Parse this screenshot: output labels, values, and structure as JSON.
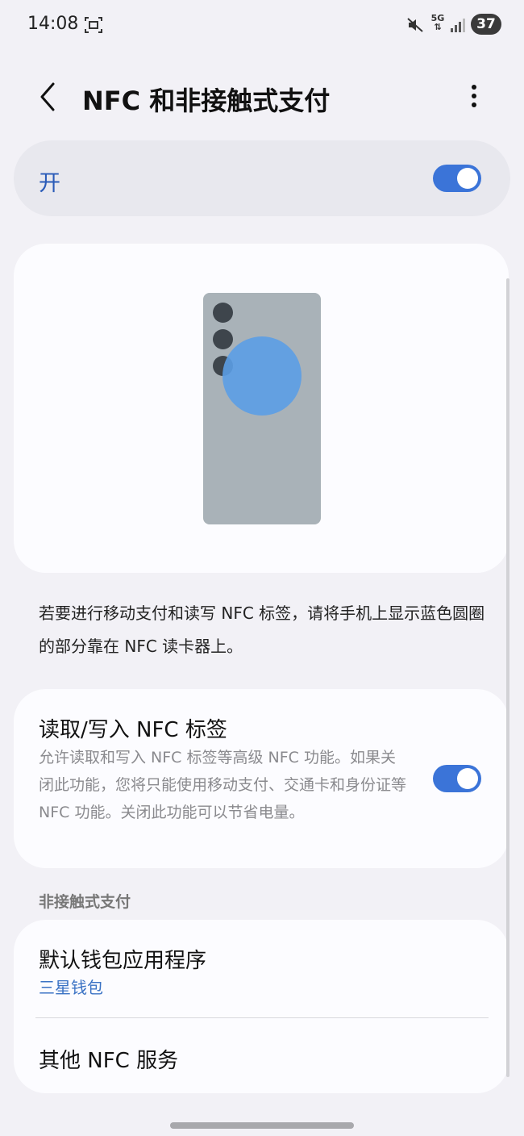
{
  "status_bar": {
    "time": "14:08",
    "network": "5G",
    "battery": "37",
    "icons": [
      "screenshot-icon",
      "mute-icon",
      "signal-icon",
      "battery-icon"
    ]
  },
  "header": {
    "title": "NFC 和非接触式支付",
    "icons": [
      "back-icon",
      "more-vertical-icon"
    ]
  },
  "master_toggle": {
    "label": "开",
    "on": true
  },
  "description": "若要进行移动支付和读写 NFC 标签，请将手机上显示蓝色圆圈的部分靠在 NFC 读卡器上。",
  "read_write": {
    "title": "读取/写入 NFC 标签",
    "subtitle": "允许读取和写入 NFC 标签等高级 NFC 功能。如果关闭此功能，您将只能使用移动支付、交通卡和身份证等 NFC 功能。关闭此功能可以节省电量。",
    "on": true
  },
  "contactless": {
    "section_title": "非接触式支付",
    "default_wallet_title": "默认钱包应用程序",
    "default_wallet_value": "三星钱包",
    "other_services": "其他 NFC 服务"
  },
  "colors": {
    "accent": "#3b74d8",
    "link": "#3a72c4",
    "background": "#f2f1f6",
    "card": "#fcfcff"
  }
}
